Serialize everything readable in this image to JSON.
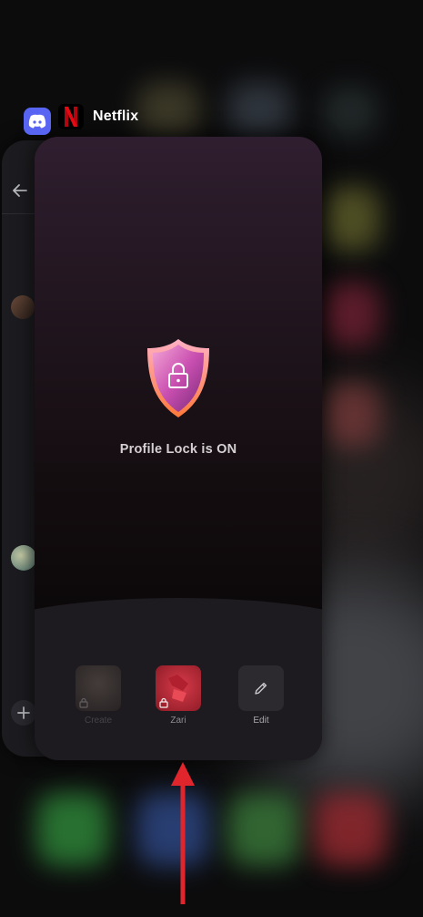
{
  "colors": {
    "netflix_red": "#E50914",
    "discord_blurple": "#5865F2",
    "arrow_red": "#E0262C",
    "shield_pink": "#C94FB0"
  },
  "switcher": {
    "active_app_name": "Netflix",
    "background_app_icon": "discord-icon"
  },
  "netflix": {
    "status_text": "Profile Lock is ON",
    "shield_icon": "shield-lock-icon",
    "profiles": [
      {
        "name": "Create",
        "locked": true,
        "faded": true
      },
      {
        "name": "Zari",
        "locked": true,
        "faded": false
      }
    ],
    "edit_label": "Edit",
    "edit_icon": "pencil-icon"
  },
  "discord": {
    "back_icon": "arrow-left-icon",
    "add_icon": "plus-icon"
  },
  "annotation": {
    "icon": "arrow-up-icon"
  }
}
